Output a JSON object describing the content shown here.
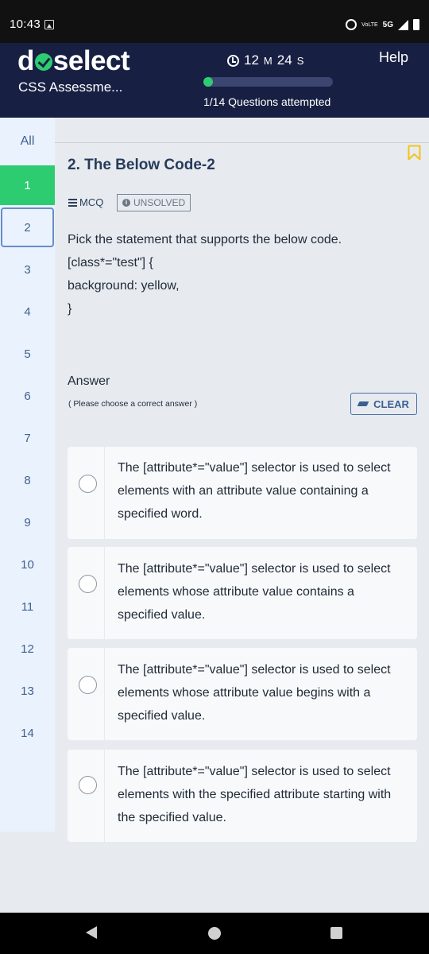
{
  "status_bar": {
    "time": "10:43",
    "volte": "VoLTE",
    "network": "5G"
  },
  "header": {
    "logo_prefix": "d",
    "logo_suffix": "select",
    "assessment": "CSS Assessme...",
    "timer_minutes": "12",
    "timer_min_unit": "M",
    "timer_seconds": "24",
    "timer_sec_unit": "S",
    "progress_fraction": 0.071,
    "progress_text": "1/14 Questions attempted",
    "help": "Help"
  },
  "sidebar": {
    "all_label": "All",
    "items": [
      {
        "label": "1",
        "state": "answered"
      },
      {
        "label": "2",
        "state": "current"
      },
      {
        "label": "3",
        "state": "default"
      },
      {
        "label": "4",
        "state": "default"
      },
      {
        "label": "5",
        "state": "default"
      },
      {
        "label": "6",
        "state": "default"
      },
      {
        "label": "7",
        "state": "default"
      },
      {
        "label": "8",
        "state": "default"
      },
      {
        "label": "9",
        "state": "default"
      },
      {
        "label": "10",
        "state": "default"
      },
      {
        "label": "11",
        "state": "default"
      },
      {
        "label": "12",
        "state": "default"
      },
      {
        "label": "13",
        "state": "default"
      },
      {
        "label": "14",
        "state": "default"
      }
    ]
  },
  "question": {
    "title": "2. The Below Code-2",
    "type": "MCQ",
    "status": "UNSOLVED",
    "lines": [
      "Pick the statement that supports the below code.",
      "[class*=\"test\"] {",
      "background: yellow,",
      "}"
    ]
  },
  "answer": {
    "label": "Answer",
    "hint": "( Please choose a correct answer )",
    "clear": "CLEAR",
    "options": [
      "The [attribute*=\"value\"] selector is used to select elements with an attribute value containing a specified word.",
      "The [attribute*=\"value\"] selector is used to select elements whose attribute value contains a specified value.",
      "The [attribute*=\"value\"] selector is used to select elements whose attribute value begins with a specified value.",
      "The [attribute*=\"value\"] selector is used to select elements with the specified attribute starting with the specified value."
    ]
  },
  "colors": {
    "header_bg": "#172043",
    "accent_green": "#2ecc71",
    "sidebar_bg": "#eaf3fd",
    "bookmark": "#f0c419"
  }
}
